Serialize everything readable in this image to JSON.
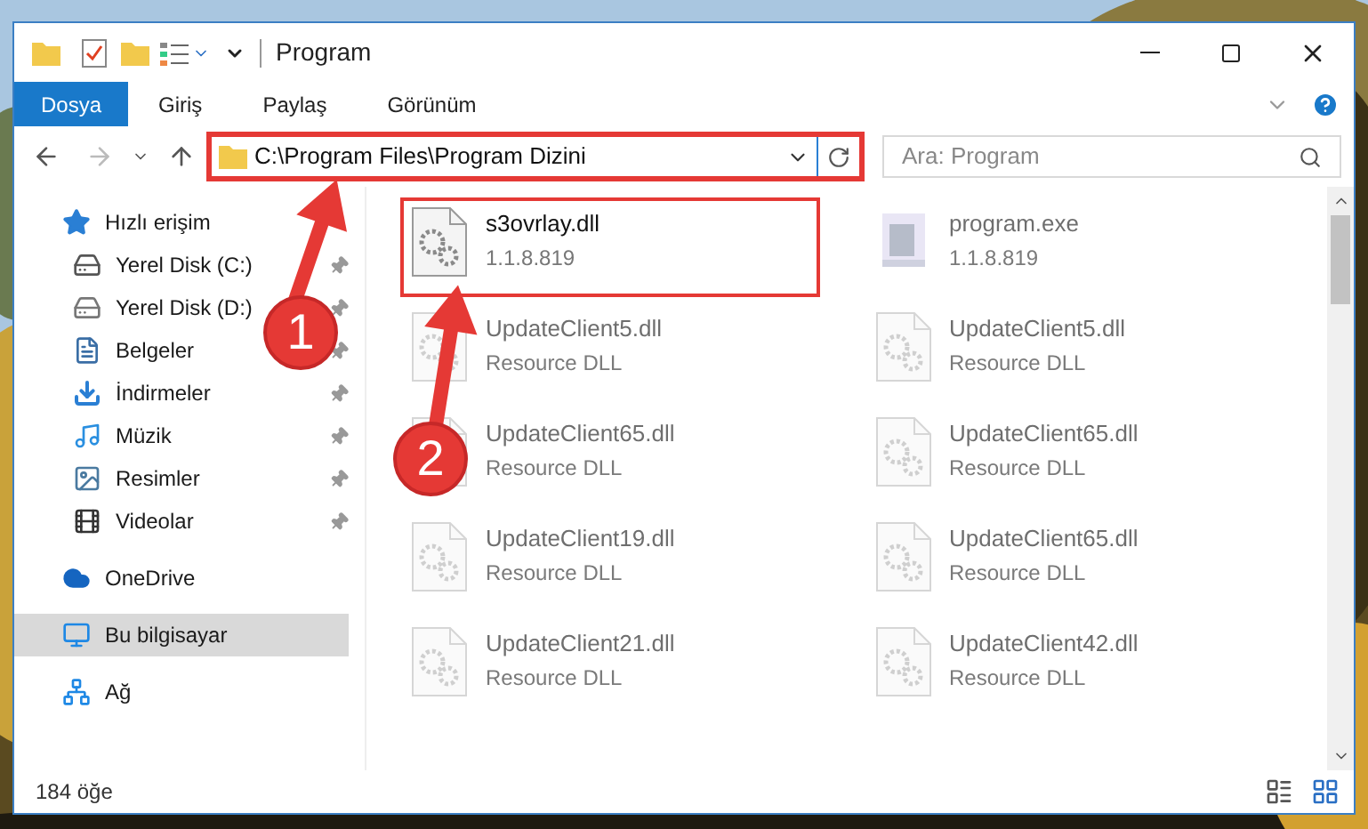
{
  "window": {
    "title": "Program"
  },
  "ribbon_tabs": [
    {
      "label": "Dosya",
      "selected": true
    },
    {
      "label": "Giriş",
      "selected": false
    },
    {
      "label": "Paylaş",
      "selected": false
    },
    {
      "label": "Görünüm",
      "selected": false
    }
  ],
  "address": {
    "value": "C:\\Program Files\\Program Dizini",
    "highlighted": true
  },
  "search": {
    "placeholder": "Ara: Program"
  },
  "sidebar": {
    "items": [
      {
        "label": "Hızlı erişim",
        "kind": "star",
        "selected": false,
        "children": [
          {
            "label": "Yerel Disk (C:)",
            "kind": "system-drive",
            "pinned": true
          },
          {
            "label": "Yerel Disk (D:)",
            "kind": "drive",
            "pinned": true
          },
          {
            "label": "Belgeler",
            "kind": "document",
            "pinned": true
          },
          {
            "label": "İndirmeler",
            "kind": "download",
            "pinned": true
          },
          {
            "label": "Müzik",
            "kind": "music",
            "pinned": true
          },
          {
            "label": "Resimler",
            "kind": "picture",
            "pinned": true
          },
          {
            "label": "Videolar",
            "kind": "video",
            "pinned": true
          }
        ]
      },
      {
        "label": "OneDrive",
        "kind": "cloud",
        "selected": false
      },
      {
        "label": "Bu bilgisayar",
        "kind": "computer",
        "selected": true
      },
      {
        "label": "Ağ",
        "kind": "network",
        "selected": false
      }
    ]
  },
  "files": [
    {
      "name": "s3ovrlay.dll",
      "detail": "1.1.8.819",
      "kind": "dll",
      "blurred": false,
      "highlighted": true
    },
    {
      "name": "program.exe",
      "detail": "1.1.8.819",
      "kind": "exe",
      "blurred": true,
      "highlighted": false
    },
    {
      "name": "UpdateClient5.dll",
      "detail": "Resource DLL",
      "kind": "dll",
      "blurred": true,
      "highlighted": false
    },
    {
      "name": "UpdateClient5.dll",
      "detail": "Resource DLL",
      "kind": "dll",
      "blurred": true,
      "highlighted": false
    },
    {
      "name": "UpdateClient65.dll",
      "detail": "Resource DLL",
      "kind": "dll",
      "blurred": true,
      "highlighted": false
    },
    {
      "name": "UpdateClient65.dll",
      "detail": "Resource DLL",
      "kind": "dll",
      "blurred": true,
      "highlighted": false
    },
    {
      "name": "UpdateClient19.dll",
      "detail": "Resource DLL",
      "kind": "dll",
      "blurred": true,
      "highlighted": false
    },
    {
      "name": "UpdateClient65.dll",
      "detail": "Resource DLL",
      "kind": "dll",
      "blurred": true,
      "highlighted": false
    },
    {
      "name": "UpdateClient21.dll",
      "detail": "Resource DLL",
      "kind": "dll",
      "blurred": true,
      "highlighted": false
    },
    {
      "name": "UpdateClient42.dll",
      "detail": "Resource DLL",
      "kind": "dll",
      "blurred": true,
      "highlighted": false
    }
  ],
  "status_bar": {
    "count": "184 öğe"
  },
  "annotations": [
    {
      "label": "1"
    },
    {
      "label": "2"
    }
  ]
}
